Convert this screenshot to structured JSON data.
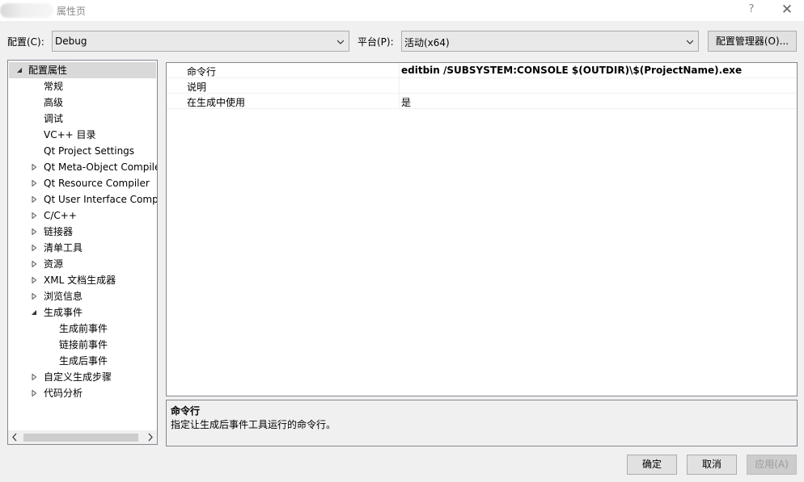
{
  "window": {
    "title": "属性页",
    "help_label": "?",
    "close_label": "✕"
  },
  "config": {
    "label": "配置(C):",
    "value": "Debug",
    "platform_label": "平台(P):",
    "platform_value": "活动(x64)",
    "manager_label": "配置管理器(O)..."
  },
  "tree": {
    "root_label": "配置属性",
    "items": [
      {
        "label": "常规"
      },
      {
        "label": "高级"
      },
      {
        "label": "调试"
      },
      {
        "label": "VC++ 目录"
      },
      {
        "label": "Qt Project Settings"
      },
      {
        "label": "Qt Meta-Object Compiler"
      },
      {
        "label": "Qt Resource Compiler"
      },
      {
        "label": "Qt User Interface Compiler"
      },
      {
        "label": "C/C++"
      },
      {
        "label": "链接器"
      },
      {
        "label": "清单工具"
      },
      {
        "label": "资源"
      },
      {
        "label": "XML 文档生成器"
      },
      {
        "label": "浏览信息"
      },
      {
        "label": "生成事件"
      },
      {
        "label": "生成前事件"
      },
      {
        "label": "链接前事件"
      },
      {
        "label": "生成后事件"
      },
      {
        "label": "自定义生成步骤"
      },
      {
        "label": "代码分析"
      }
    ]
  },
  "grid": {
    "rows": [
      {
        "name": "命令行",
        "value": "editbin /SUBSYSTEM:CONSOLE $(OUTDIR)\\$(ProjectName).exe"
      },
      {
        "name": "说明",
        "value": ""
      },
      {
        "name": "在生成中使用",
        "value": "是"
      }
    ]
  },
  "description": {
    "title": "命令行",
    "text": "指定让生成后事件工具运行的命令行。"
  },
  "buttons": {
    "ok": "确定",
    "cancel": "取消",
    "apply": "应用(A)"
  },
  "colors": {
    "selection": "#d9d9d9",
    "border": "#828790",
    "disabled_text": "#9a9a9a"
  }
}
